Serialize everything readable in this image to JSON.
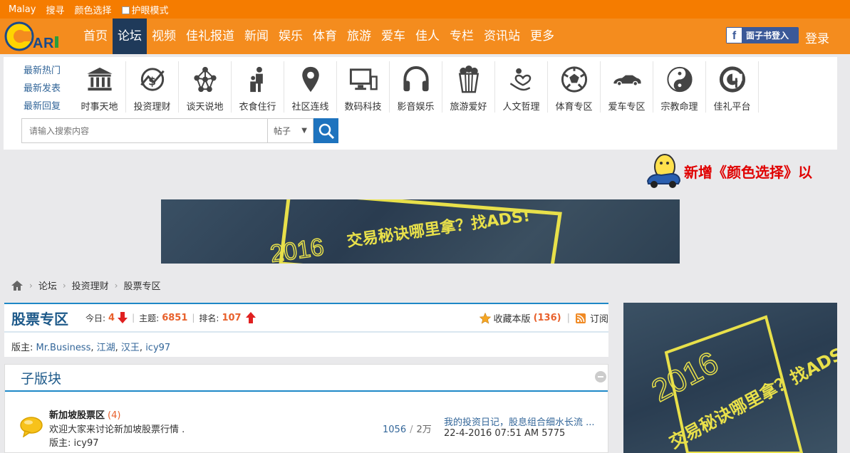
{
  "topbar": {
    "lang": "Malay",
    "search": "搜寻",
    "color": "颜色选择",
    "eyecare": "护眼模式"
  },
  "nav": {
    "items": [
      "首页",
      "论坛",
      "视频",
      "佳礼报道",
      "新闻",
      "娱乐",
      "体育",
      "旅游",
      "爱车",
      "佳人",
      "专栏",
      "资讯站",
      "更多"
    ],
    "active_index": 1,
    "fb_login": "面子书登入",
    "login": "登录"
  },
  "quicklinks": [
    "最新热门",
    "最新发表",
    "最新回复"
  ],
  "categories": [
    {
      "label": "时事天地",
      "icon": "government-building-icon"
    },
    {
      "label": "投资理财",
      "icon": "finance-chart-icon"
    },
    {
      "label": "谈天说地",
      "icon": "network-icon"
    },
    {
      "label": "衣食住行",
      "icon": "family-icon"
    },
    {
      "label": "社区连线",
      "icon": "location-pin-icon"
    },
    {
      "label": "数码科技",
      "icon": "computer-icon"
    },
    {
      "label": "影音娱乐",
      "icon": "headphones-icon"
    },
    {
      "label": "旅游爱好",
      "icon": "popcorn-icon"
    },
    {
      "label": "人文哲理",
      "icon": "heart-hand-icon"
    },
    {
      "label": "体育专区",
      "icon": "soccer-ball-icon"
    },
    {
      "label": "爱车专区",
      "icon": "car-icon"
    },
    {
      "label": "宗教命理",
      "icon": "yin-yang-icon"
    },
    {
      "label": "佳礼平台",
      "icon": "cari-platform-icon"
    }
  ],
  "search": {
    "placeholder": "请输入搜索内容",
    "type": "帖子"
  },
  "notice": "新增《颜色选择》以",
  "banner": {
    "year": "2016",
    "text": "交易秘诀哪里拿？找ADS!"
  },
  "breadcrumb": [
    "论坛",
    "投资理财",
    "股票专区"
  ],
  "forum": {
    "title": "股票专区",
    "today_label": "今日:",
    "today": "4",
    "topics_label": "主题:",
    "topics": "6851",
    "rank_label": "排名:",
    "rank": "107",
    "favorite_label": "收藏本版",
    "favorite_count": "(136)",
    "subscribe_label": "订阅",
    "mods_label": "版主:",
    "mods": [
      "Mr.Business",
      "江湖",
      "汉王",
      "icy97"
    ]
  },
  "subforums": {
    "title": "子版块",
    "items": [
      {
        "name": "新加坡股票区",
        "today": "(4)",
        "desc": "欢迎大家来讨论新加坡股票行情 .",
        "mod_label": "版主:",
        "mod": "icy97",
        "threads": "1056",
        "posts": "2万",
        "last_title": "我的投资日记，股息组合细水长流 ...",
        "last_meta": "22-4-2016 07:51 AM 5775"
      }
    ]
  },
  "colors": {
    "topbar": "#f57c00",
    "navbar": "#f48c1e",
    "nav_active": "#1f3a5a",
    "accent": "#1e88c7",
    "stat": "#e8612c",
    "notice": "#e00000"
  }
}
